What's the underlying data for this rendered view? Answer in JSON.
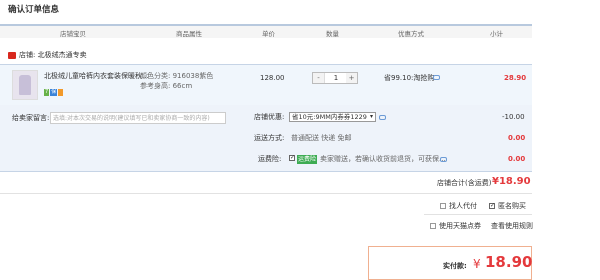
{
  "page_title": "确认订单信息",
  "columns": [
    "店铺宝贝",
    "商品属性",
    "单价",
    "数量",
    "优惠方式",
    "小计"
  ],
  "shop": {
    "label": "店铺:",
    "name": "北极绒杰通专卖"
  },
  "item": {
    "name": "北极绒儿童哈裤内衣套装保暖秋...",
    "color_label": "颜色分类: 916038紫色",
    "size_label": "参考身高: 66cm",
    "badges": [
      "7",
      "保"
    ],
    "unit_price": "128.00",
    "quantity": "1",
    "qty_minus": "-",
    "qty_plus": "+",
    "discount": "省99.10:淘抢购",
    "subtotal": "28.90"
  },
  "message": {
    "label": "给卖家留言:",
    "placeholder": "选填:对本次交易的说明(建议填写已和卖家协商一致的内容)"
  },
  "coupon": {
    "label": "店铺优惠:",
    "selected": "省10元:9MM内券券1229",
    "amount": "-10.00"
  },
  "shipping": {
    "label": "运送方式:",
    "value": "普通配送 快递 免邮",
    "amount": "0.00"
  },
  "insurance": {
    "label": "运费险:",
    "tag": "运费险",
    "text": "卖家赠送，若确认收货前退货，可获保...",
    "amount": "0.00"
  },
  "shop_total": {
    "label": "店铺合计(含运费)",
    "value": "¥18.90"
  },
  "extras": {
    "proxy_pay": "找人代付",
    "anonymous": "匿名购买",
    "tmall_points": "使用天猫点券",
    "points_rule": "查看使用规则"
  },
  "pay": {
    "label": "实付款:",
    "symbol": "¥",
    "value": "18.90"
  },
  "colors": {
    "accent_red": "#e4393c",
    "link_blue": "#3b69b5",
    "header_line": "#b8c9de",
    "row_bg": "#f0f6fc"
  }
}
